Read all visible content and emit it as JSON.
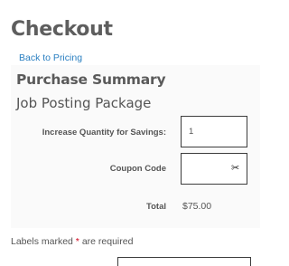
{
  "page": {
    "title": "Checkout",
    "back_link": "Back to Pricing"
  },
  "summary": {
    "title": "Purchase Summary",
    "package_name": "Job Posting Package",
    "quantity_label": "Increase Quantity for Savings:",
    "quantity_value": "1",
    "coupon_label": "Coupon Code",
    "coupon_value": "",
    "coupon_icon": "scissors-icon",
    "total_label": "Total",
    "total_value": "$75.00"
  },
  "form": {
    "required_prefix": "Labels marked",
    "required_marker": "*",
    "required_suffix": "are required"
  },
  "colors": {
    "link": "#2a7fc1",
    "required": "#d0021b",
    "heading": "#5e5e5e"
  }
}
